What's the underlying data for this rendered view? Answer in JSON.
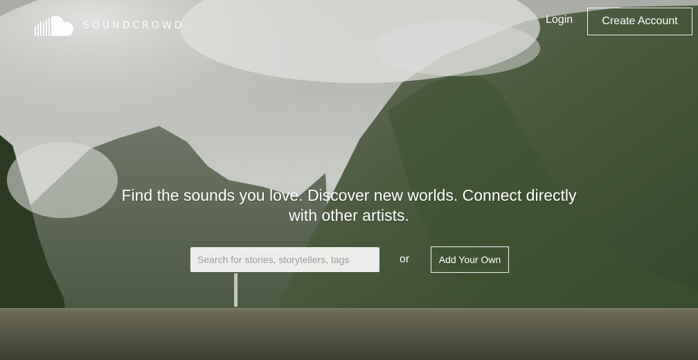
{
  "brand": {
    "name": "SOUNDCROWD",
    "logo_icon": "cloud-waveform-icon"
  },
  "nav": {
    "login_label": "Login",
    "create_account_label": "Create Account"
  },
  "hero": {
    "headline": "Find the sounds you love. Discover new worlds. Connect directly with other artists.",
    "search_placeholder": "Search for stories, storytellers, tags",
    "or_text": "or",
    "add_button_label": "Add Your Own"
  },
  "colors": {
    "sky": "#c9cbc6",
    "water": "#5f5f4a",
    "mountain": "#3f4f34"
  }
}
